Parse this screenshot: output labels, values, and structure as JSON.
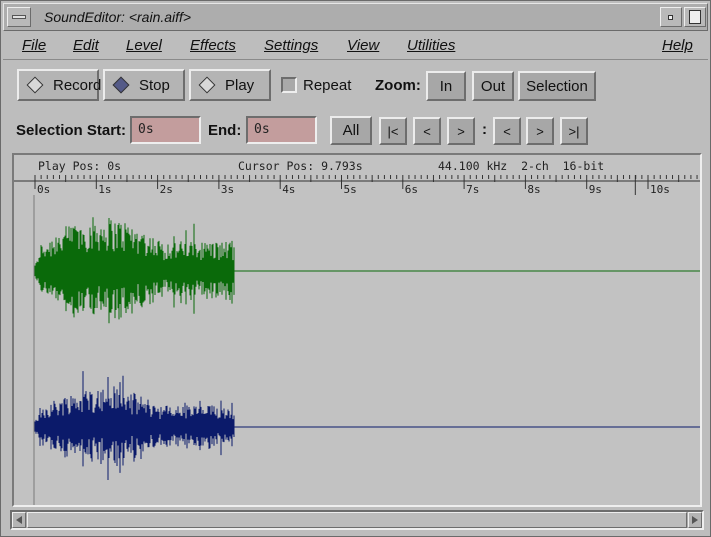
{
  "window": {
    "title": "SoundEditor: <rain.aiff>"
  },
  "menu": {
    "file": "File",
    "edit": "Edit",
    "level": "Level",
    "effects": "Effects",
    "settings": "Settings",
    "view": "View",
    "utilities": "Utilities",
    "help": "Help"
  },
  "transport": {
    "record": "Record",
    "stop": "Stop",
    "play": "Play",
    "selected_mode": "Stop",
    "repeat_label": "Repeat",
    "repeat_checked": false
  },
  "zoom": {
    "label": "Zoom:",
    "in": "In",
    "out": "Out",
    "selection": "Selection"
  },
  "selection": {
    "start_label": "Selection Start:",
    "start_value": "0s",
    "end_label": "End:",
    "end_value": "0s",
    "all": "All",
    "go_start": "|<",
    "step_back": "<",
    "step_forward": ">",
    "separator": ":",
    "sel_back": "<",
    "sel_forward": ">",
    "go_end": ">|"
  },
  "status": {
    "play_pos": "Play Pos: 0s",
    "cursor_pos": "Cursor Pos: 9.793s",
    "format": "44.100 kHz  2-ch  16-bit"
  },
  "ruler": {
    "labels": [
      "0s",
      "1s",
      "2s",
      "3s",
      "4s",
      "5s",
      "6s",
      "7s",
      "8s",
      "9s",
      "10s"
    ],
    "max_seconds": 10.8,
    "cursor_seconds": 9.793
  },
  "waveform": {
    "audio_end_seconds": 3.25,
    "channel_colors": [
      "#0a6a0a",
      "#0b1a6a"
    ]
  }
}
